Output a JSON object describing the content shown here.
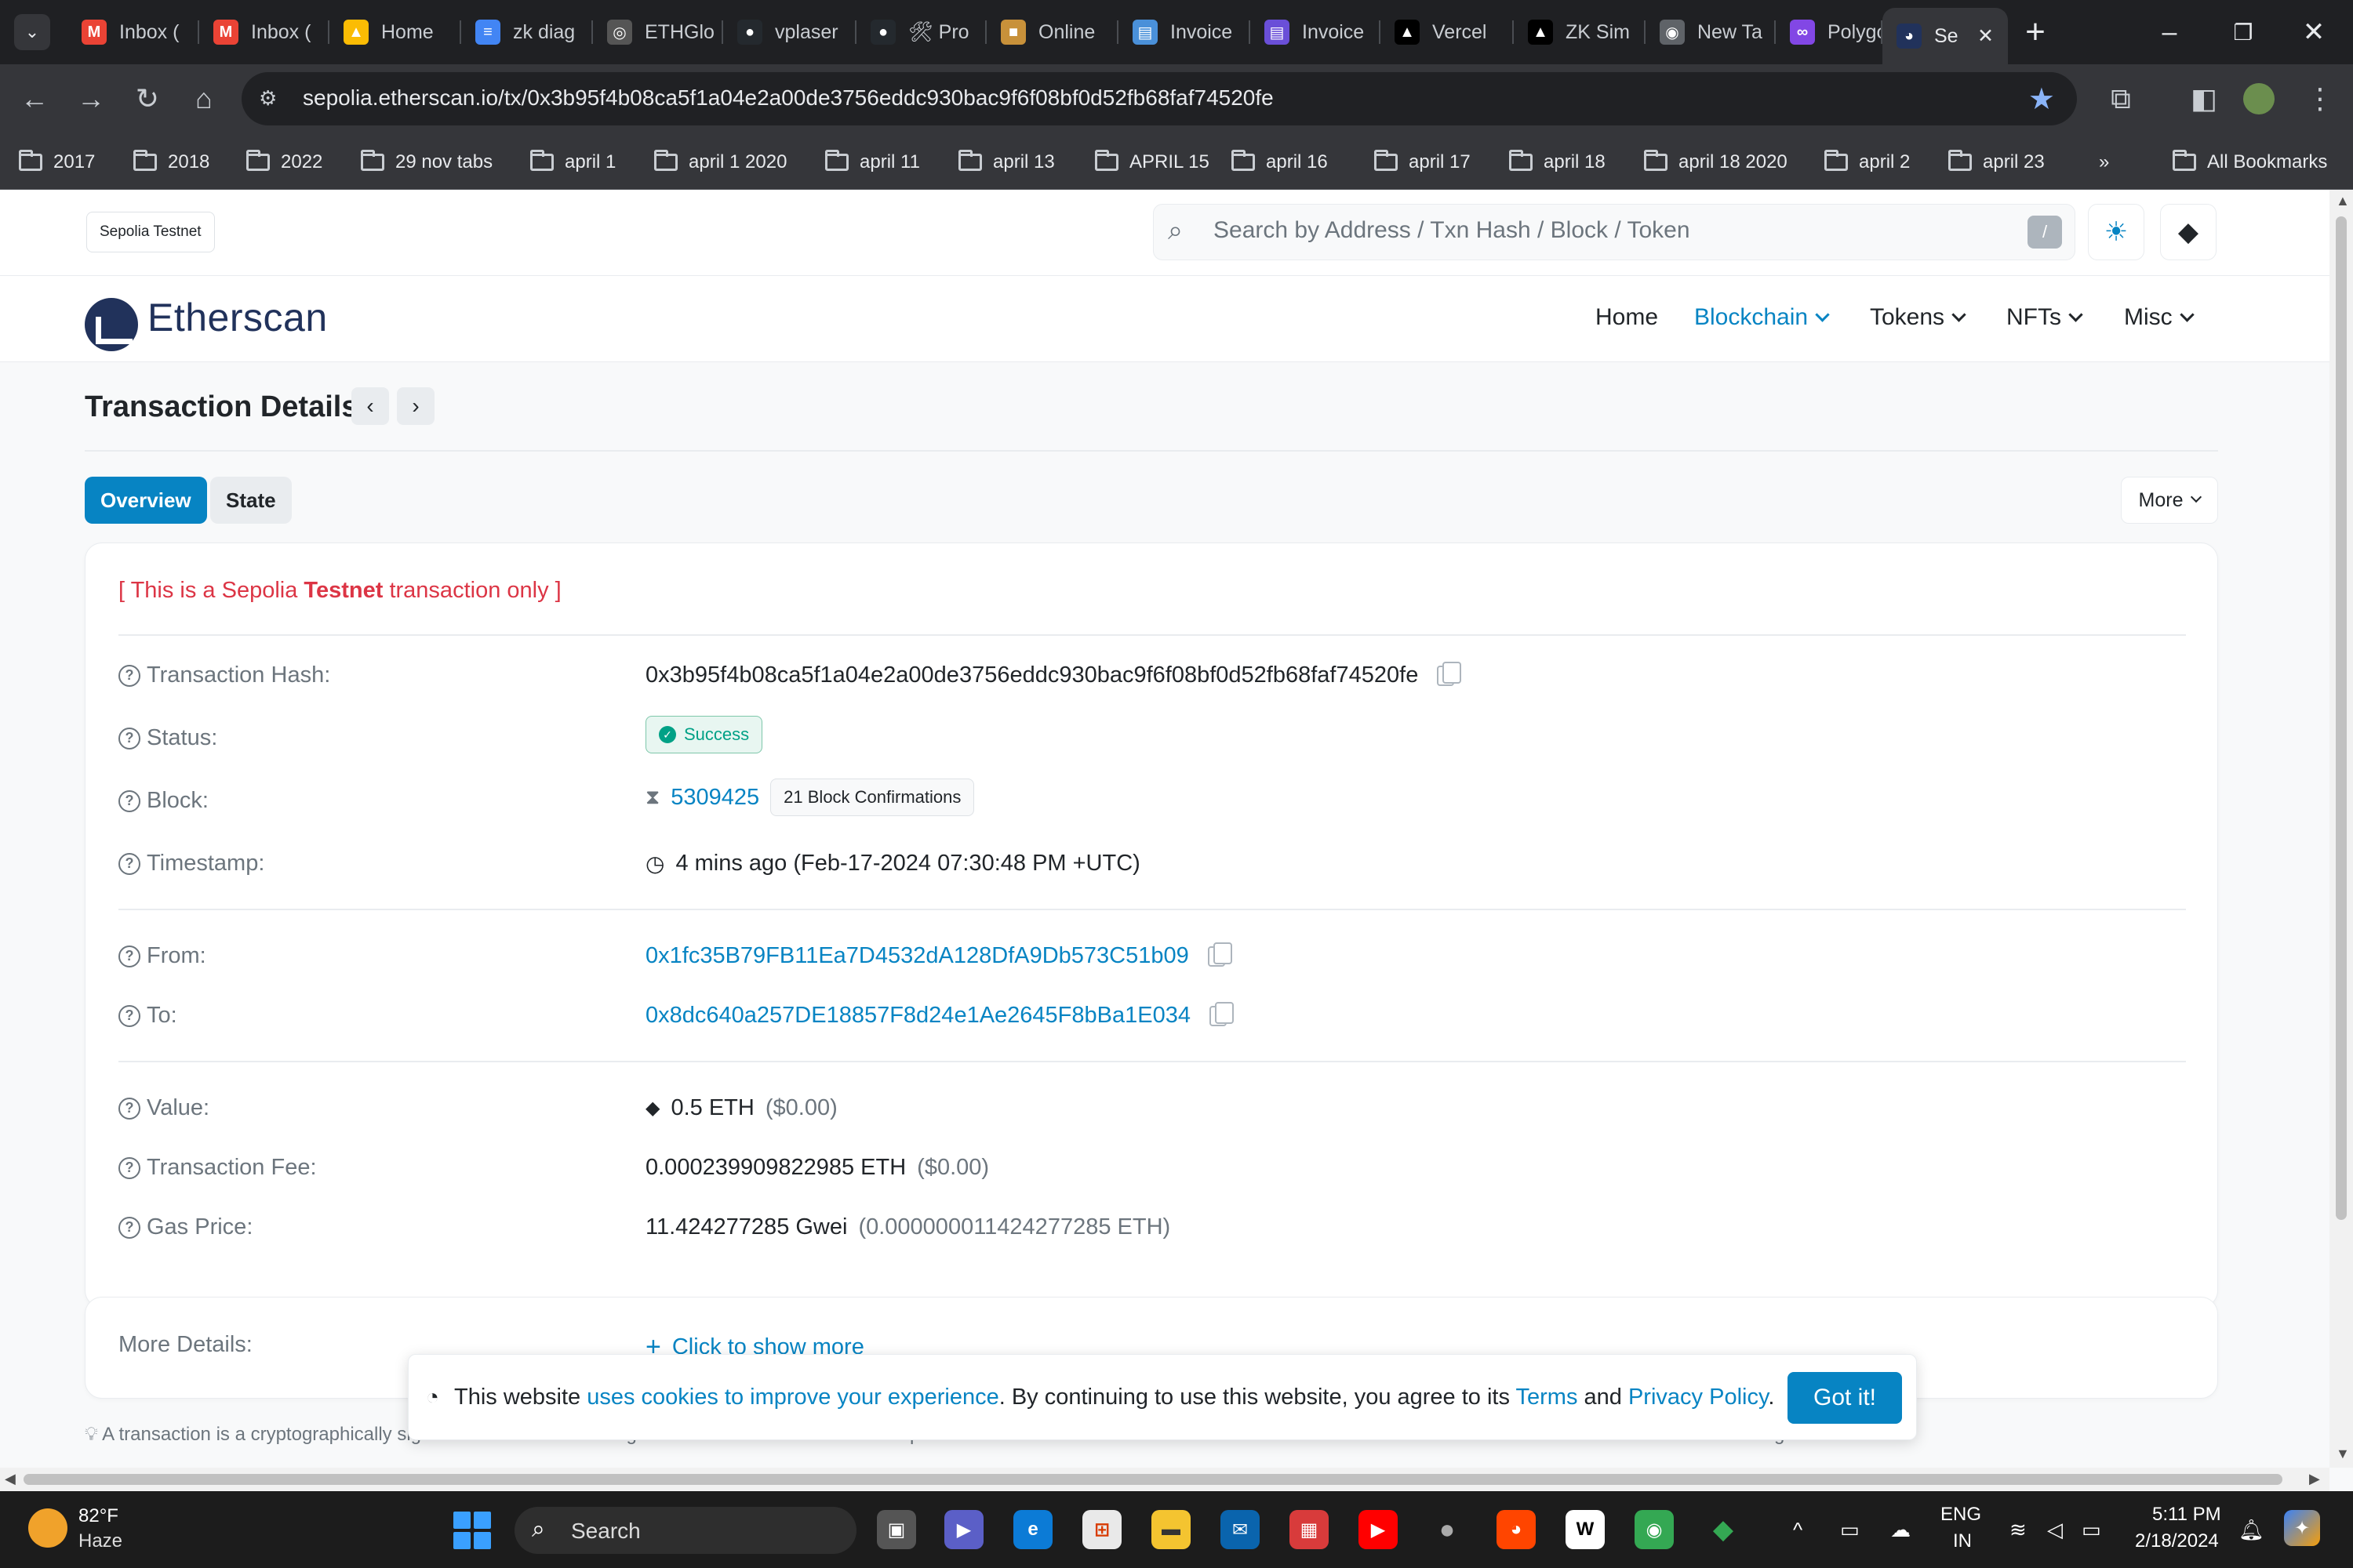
{
  "browser": {
    "tabs": [
      {
        "title": "Inbox (",
        "icon": "gmail-icon",
        "color": "#ea4335",
        "glyph": "M"
      },
      {
        "title": "Inbox (",
        "icon": "gmail-icon",
        "color": "#ea4335",
        "glyph": "M"
      },
      {
        "title": "Home",
        "icon": "drive-icon",
        "color": "#fbbc04",
        "glyph": "▲"
      },
      {
        "title": "zk diag",
        "icon": "docs-icon",
        "color": "#4285f4",
        "glyph": "≡"
      },
      {
        "title": "ETHGlo",
        "icon": "ethglobal-icon",
        "color": "#555555",
        "glyph": "◎"
      },
      {
        "title": "vplaser",
        "icon": "github-icon",
        "color": "#24292e",
        "glyph": "●"
      },
      {
        "title": "🛠 Pro",
        "icon": "github-icon",
        "color": "#24292e",
        "glyph": "●"
      },
      {
        "title": "Online",
        "icon": "package-icon",
        "color": "#c8913a",
        "glyph": "■"
      },
      {
        "title": "Invoice",
        "icon": "invoice-icon",
        "color": "#4a90d9",
        "glyph": "▤"
      },
      {
        "title": "Invoice",
        "icon": "invoice-icon",
        "color": "#6a4fd8",
        "glyph": "▤"
      },
      {
        "title": "Vercel",
        "icon": "vercel-icon",
        "color": "#000000",
        "glyph": "▲"
      },
      {
        "title": "ZK Sim",
        "icon": "vercel-icon",
        "color": "#000000",
        "glyph": "▲"
      },
      {
        "title": "New Ta",
        "icon": "chrome-icon",
        "color": "#5f6368",
        "glyph": "◉"
      },
      {
        "title": "Polygo",
        "icon": "polygon-icon",
        "color": "#8247e5",
        "glyph": "∞"
      },
      {
        "title": "Se",
        "icon": "etherscan-icon",
        "color": "#21325b",
        "glyph": "◕"
      }
    ],
    "url": "sepolia.etherscan.io/tx/0x3b95f4b08ca5f1a04e2a00de3756eddc930bac9f6f08bf0d52fb68faf74520fe",
    "bookmarks": [
      "2017",
      "2018",
      "2022",
      "29 nov tabs",
      "april 1",
      "april 1 2020",
      "april 11",
      "april 13",
      "APRIL 15",
      "april 16",
      "april 17",
      "april 18",
      "april 18 2020",
      "april 2",
      "april 23"
    ],
    "all_bookmarks_label": "All Bookmarks"
  },
  "site": {
    "network_badge": "Sepolia Testnet",
    "search_placeholder": "Search by Address / Txn Hash / Block / Token",
    "search_shortcut": "/",
    "logo_text": "Etherscan",
    "nav": {
      "home": "Home",
      "blockchain": "Blockchain",
      "tokens": "Tokens",
      "nfts": "NFTs",
      "misc": "Misc"
    },
    "accent_color": "#0784c3"
  },
  "page": {
    "title": "Transaction Details",
    "tabs": {
      "overview": "Overview",
      "state": "State"
    },
    "more_label": "More",
    "notice_prefix": "[ This is a Sepolia ",
    "notice_bold": "Testnet",
    "notice_suffix": " transaction only ]"
  },
  "tx": {
    "labels": {
      "hash": "Transaction Hash:",
      "status": "Status:",
      "block": "Block:",
      "timestamp": "Timestamp:",
      "from": "From:",
      "to": "To:",
      "value": "Value:",
      "fee": "Transaction Fee:",
      "gas_price": "Gas Price:",
      "more_details": "More Details:"
    },
    "hash": "0x3b95f4b08ca5f1a04e2a00de3756eddc930bac9f6f08bf0d52fb68faf74520fe",
    "status": "Success",
    "block": "5309425",
    "confirmations": "21 Block Confirmations",
    "timestamp": "4 mins ago (Feb-17-2024 07:30:48 PM +UTC)",
    "from": "0x1fc35B79FB11Ea7D4532dA128DfA9Db573C51b09",
    "to": "0x8dc640a257DE18857F8d24e1Ae2645F8bBa1E034",
    "value": "0.5 ETH",
    "value_usd": "($0.00)",
    "fee": "0.000239909822985 ETH",
    "fee_usd": "($0.00)",
    "gas_price": "11.424277285 Gwei",
    "gas_price_eth": "(0.000000011424277285 ETH)",
    "show_more": "Click to show more"
  },
  "cookie": {
    "text_1": "This website ",
    "link_1": "uses cookies to improve your experience",
    "text_2": ". By continuing to use this website, you agree to its ",
    "link_terms": "Terms",
    "text_3": " and ",
    "link_privacy": "Privacy Policy",
    "text_4": ".",
    "button": "Got it!"
  },
  "footnote": "A transaction is a cryptographically signed instruction that changes the blockchain state. Block explorers track the details of all transactions in the network. Learn more about transactions in our Knowledge Base.",
  "taskbar": {
    "weather_temp": "82°F",
    "weather_desc": "Haze",
    "search_label": "Search",
    "lang": "ENG",
    "region": "IN",
    "time": "5:11 PM",
    "date": "2/18/2024"
  }
}
